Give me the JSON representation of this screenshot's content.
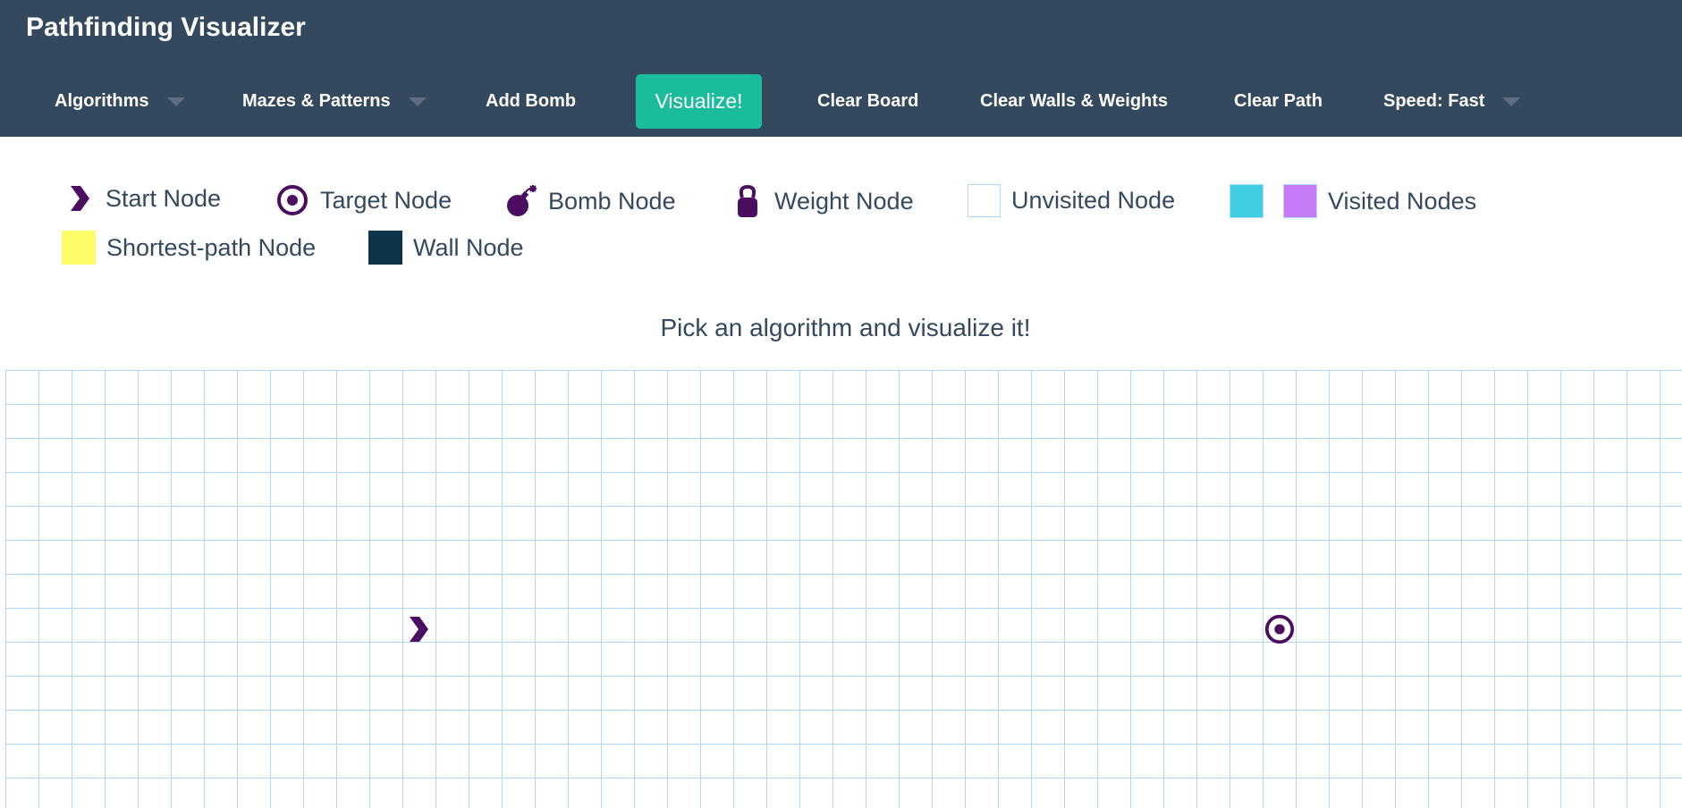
{
  "app": {
    "title": "Pathfinding Visualizer"
  },
  "nav": {
    "algorithms": "Algorithms",
    "mazes": "Mazes & Patterns",
    "add_bomb": "Add Bomb",
    "visualize": "Visualize!",
    "clear_board": "Clear Board",
    "clear_walls": "Clear Walls & Weights",
    "clear_path": "Clear Path",
    "speed": "Speed: Fast"
  },
  "legend": {
    "start": "Start Node",
    "target": "Target Node",
    "bomb": "Bomb Node",
    "weight": "Weight Node",
    "unvisited": "Unvisited Node",
    "visited": "Visited Nodes",
    "shortest": "Shortest-path Node",
    "wall": "Wall Node"
  },
  "instructions": "Pick an algorithm and visualize it!",
  "colors": {
    "navbar": "#34495e",
    "accent": "#1abc9c",
    "node_icon": "#4b0d60",
    "grid_line": "#afd8f8",
    "visited_a": "#40cee3",
    "visited_b": "#c57af7",
    "shortest_path": "#fffe6a",
    "wall": "#0c3547"
  },
  "icons": {
    "start": "chevron-right-icon",
    "target": "target-icon",
    "bomb": "bomb-icon",
    "weight": "weight-icon",
    "dropdown": "caret-down-icon"
  }
}
